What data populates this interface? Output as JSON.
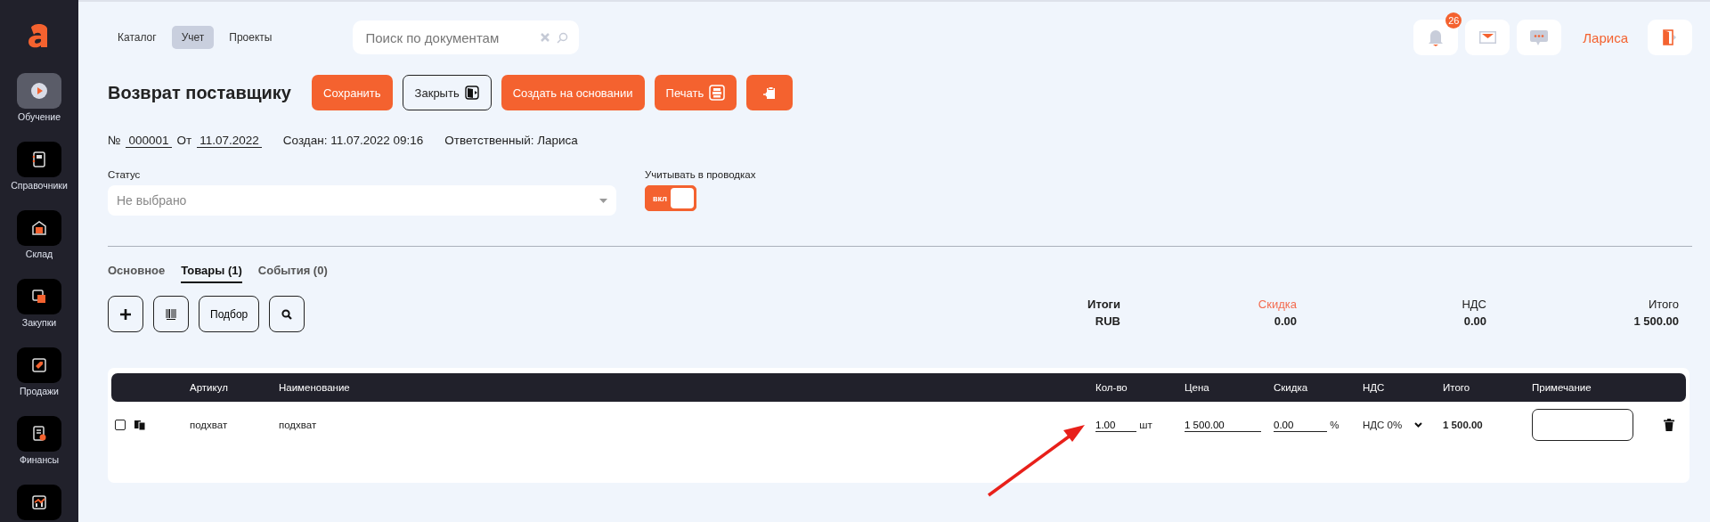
{
  "sidebar": {
    "items": [
      {
        "label": "Обучение",
        "kind": "play",
        "selected": true
      },
      {
        "label": "Справочники",
        "kind": "book",
        "selected": false
      },
      {
        "label": "Склад",
        "kind": "warehouse",
        "selected": false
      },
      {
        "label": "Закупки",
        "kind": "squares",
        "selected": false
      },
      {
        "label": "Продажи",
        "kind": "tag",
        "selected": false
      },
      {
        "label": "Финансы",
        "kind": "finance",
        "selected": false
      },
      {
        "kind": "chart",
        "selected": false
      }
    ]
  },
  "nav": [
    {
      "label": "Каталог",
      "selected": false
    },
    {
      "label": "Учет",
      "selected": true
    },
    {
      "label": "Проекты",
      "selected": false
    }
  ],
  "search": {
    "placeholder": "Поиск по документам"
  },
  "header": {
    "notifications": "26",
    "user": "Лариса"
  },
  "document": {
    "title": "Возврат поставщику",
    "actions": [
      {
        "label": "Сохранить",
        "kind": "primary"
      },
      {
        "label": "Закрыть",
        "kind": "close"
      },
      {
        "label": "Создать на основании",
        "kind": "primary"
      },
      {
        "label": "Печать",
        "kind": "print"
      },
      {
        "kind": "clipboard"
      }
    ],
    "number_label": "№",
    "number": "000001",
    "date_label": "От",
    "date": "11.07.2022",
    "created": "Создан: 11.07.2022 09:16",
    "responsible": "Ответственный: Лариса"
  },
  "status": {
    "label": "Статус",
    "placeholder": "Не выбрано"
  },
  "postings": {
    "label": "Учитывать в проводках",
    "on": true,
    "state_text": "вкл"
  },
  "tabs": [
    {
      "label": "Основное",
      "selected": false
    },
    {
      "label": "Товары (1)",
      "selected": true
    },
    {
      "label": "События (0)",
      "selected": false
    }
  ],
  "toolbar": [
    {
      "kind": "add"
    },
    {
      "kind": "barcode"
    },
    {
      "kind": "text",
      "label": "Подбор"
    },
    {
      "kind": "search"
    }
  ],
  "totals": [
    {
      "label": "Итоги",
      "value": "RUB",
      "kind": "head"
    },
    {
      "label": "Скидка",
      "value": "0.00",
      "kind": "accent"
    },
    {
      "label": "НДС",
      "value": "0.00",
      "kind": "plain"
    },
    {
      "label": "Итого",
      "value": "1 500.00",
      "kind": "plain"
    }
  ],
  "table": {
    "columns": [
      "Артикул",
      "Наименование",
      "Кол-во",
      "Цена",
      "Скидка",
      "НДС",
      "Итого",
      "Примечание"
    ],
    "rows": [
      {
        "checked": false,
        "article": "подхват",
        "name": "подхват",
        "qty": "1.00",
        "unit": "шт",
        "price": "1 500.00",
        "discount": "0.00",
        "discount_unit": "%",
        "vat": "НДС 0%",
        "total": "1 500.00"
      }
    ]
  }
}
